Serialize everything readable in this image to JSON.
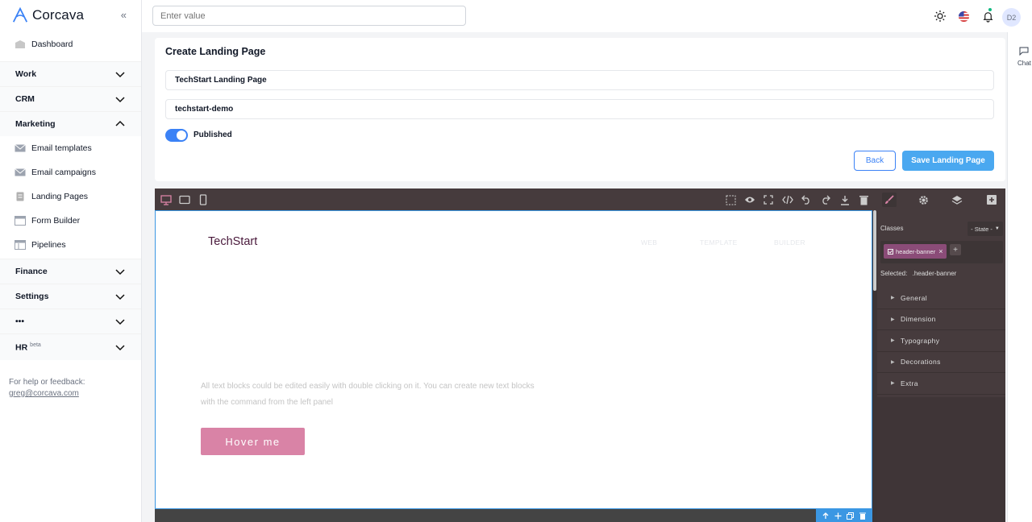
{
  "brand": {
    "name": "Corcava"
  },
  "sidebar": {
    "dashboard": "Dashboard",
    "sections": {
      "work": "Work",
      "crm": "CRM",
      "marketing": "Marketing",
      "finance": "Finance",
      "settings": "Settings",
      "more": "•••",
      "hr": "HR",
      "hr_badge": "beta"
    },
    "marketing_items": [
      "Email templates",
      "Email campaigns",
      "Landing Pages",
      "Form Builder",
      "Pipelines"
    ],
    "help_text": "For help or feedback:",
    "help_email": "greg@corcava.com"
  },
  "topbar": {
    "search_placeholder": "Enter value",
    "avatar_initials": "D2"
  },
  "chat": {
    "label": "Chat"
  },
  "form": {
    "title": "Create Landing Page",
    "name_value": "TechStart Landing Page",
    "slug_value": "techstart-demo",
    "published_label": "Published",
    "back_label": "Back",
    "save_label": "Save Landing Page"
  },
  "canvas": {
    "logo": "TechStart",
    "menu": [
      "WEB",
      "TEMPLATE",
      "BUILDER"
    ],
    "body_text": "All text blocks could be edited easily with double clicking on it. You can create new text blocks with the command from the left panel",
    "button_label": "Hover me"
  },
  "style_panel": {
    "classes_label": "Classes",
    "state_label": "- State -",
    "tag_label": "header-banner",
    "selected_label": "Selected:",
    "selected_value": ".header-banner",
    "sectors": [
      "General",
      "Dimension",
      "Typography",
      "Decorations",
      "Extra"
    ]
  },
  "colors": {
    "accent": "#3b82f6",
    "save_button": "#4aa8f0",
    "editor_bar": "#463b3d",
    "canvas_button": "#d983a6",
    "tag": "#8b4c78"
  }
}
